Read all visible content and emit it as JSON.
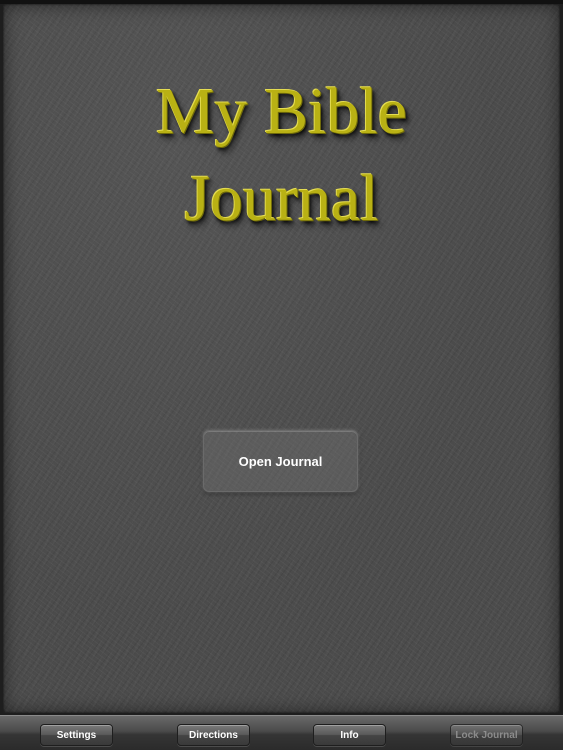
{
  "cover": {
    "title_line_1": "My Bible",
    "title_line_2": "Journal",
    "title_color": "#b9b114",
    "open_button_label": "Open Journal"
  },
  "toolbar": {
    "settings_label": "Settings",
    "directions_label": "Directions",
    "info_label": "Info",
    "lock_label": "Lock Journal"
  }
}
